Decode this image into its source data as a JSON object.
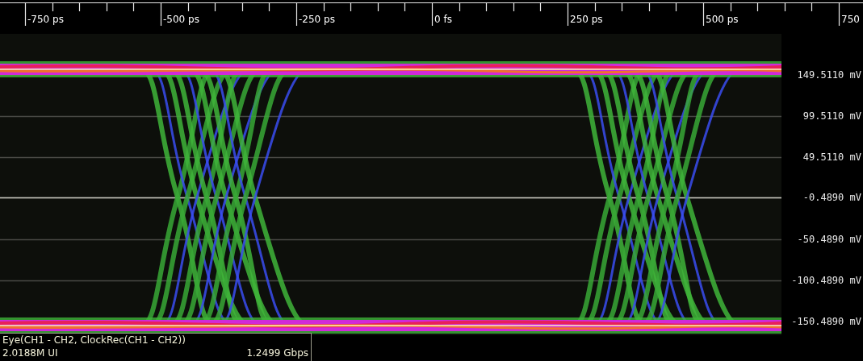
{
  "time_axis": {
    "ticks": [
      "-750 ps",
      "-500 ps",
      "-250 ps",
      "0 fs",
      "250 ps",
      "500 ps",
      "750"
    ]
  },
  "voltage_axis": {
    "ticks": [
      "149.5110 mV",
      "99.5110 mV",
      "49.5110 mV",
      "-0.4890 mV",
      "-50.4890 mV",
      "-100.4890 mV",
      "-150.4890 mV"
    ]
  },
  "info": {
    "title": "Eye(CH1 - CH2, ClockRec(CH1 - CH2))",
    "unit_intervals": "2.0188M UI",
    "bitrate": "1.2499 Gbps"
  }
}
